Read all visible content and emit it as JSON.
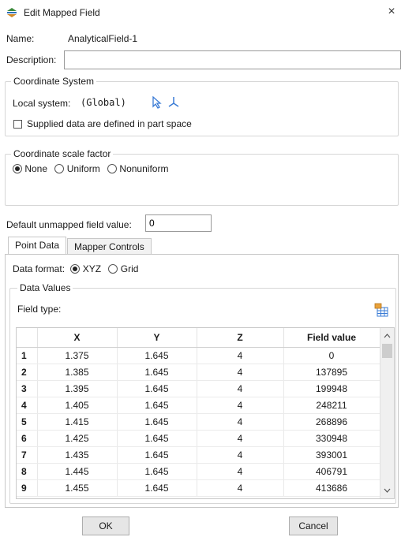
{
  "window": {
    "title": "Edit Mapped Field",
    "close_symbol": "×"
  },
  "form": {
    "name_label": "Name:",
    "name_value": "AnalyticalField-1",
    "description_label": "Description:",
    "description_value": ""
  },
  "coordinate_system": {
    "group_title": "Coordinate System",
    "local_label": "Local system:",
    "local_value": "(Global)",
    "supplied_label": "Supplied data are defined in part space",
    "supplied_checked": false
  },
  "scale_factor": {
    "group_title": "Coordinate scale factor",
    "options": [
      "None",
      "Uniform",
      "Nonuniform"
    ],
    "selected": "None"
  },
  "default_value": {
    "label": "Default unmapped field value:",
    "value": "0"
  },
  "tabs": [
    {
      "label": "Point Data",
      "active": true
    },
    {
      "label": "Mapper Controls",
      "active": false
    }
  ],
  "data_format": {
    "label": "Data format:",
    "options": [
      "XYZ",
      "Grid"
    ],
    "selected": "XYZ"
  },
  "data_values": {
    "group_title": "Data Values",
    "field_type_label": "Field type:"
  },
  "table": {
    "columns": [
      "X",
      "Y",
      "Z",
      "Field value"
    ],
    "rows": [
      [
        "1",
        "1.375",
        "1.645",
        "4",
        "0"
      ],
      [
        "2",
        "1.385",
        "1.645",
        "4",
        "137895"
      ],
      [
        "3",
        "1.395",
        "1.645",
        "4",
        "199948"
      ],
      [
        "4",
        "1.405",
        "1.645",
        "4",
        "248211"
      ],
      [
        "5",
        "1.415",
        "1.645",
        "4",
        "268896"
      ],
      [
        "6",
        "1.425",
        "1.645",
        "4",
        "330948"
      ],
      [
        "7",
        "1.435",
        "1.645",
        "4",
        "393001"
      ],
      [
        "8",
        "1.445",
        "1.645",
        "4",
        "406791"
      ],
      [
        "9",
        "1.455",
        "1.645",
        "4",
        "413686"
      ]
    ]
  },
  "buttons": {
    "ok": "OK",
    "cancel": "Cancel"
  },
  "colors": {
    "accent_icon": "#3a7bd5",
    "selection_blue": "#2f6fcf"
  }
}
